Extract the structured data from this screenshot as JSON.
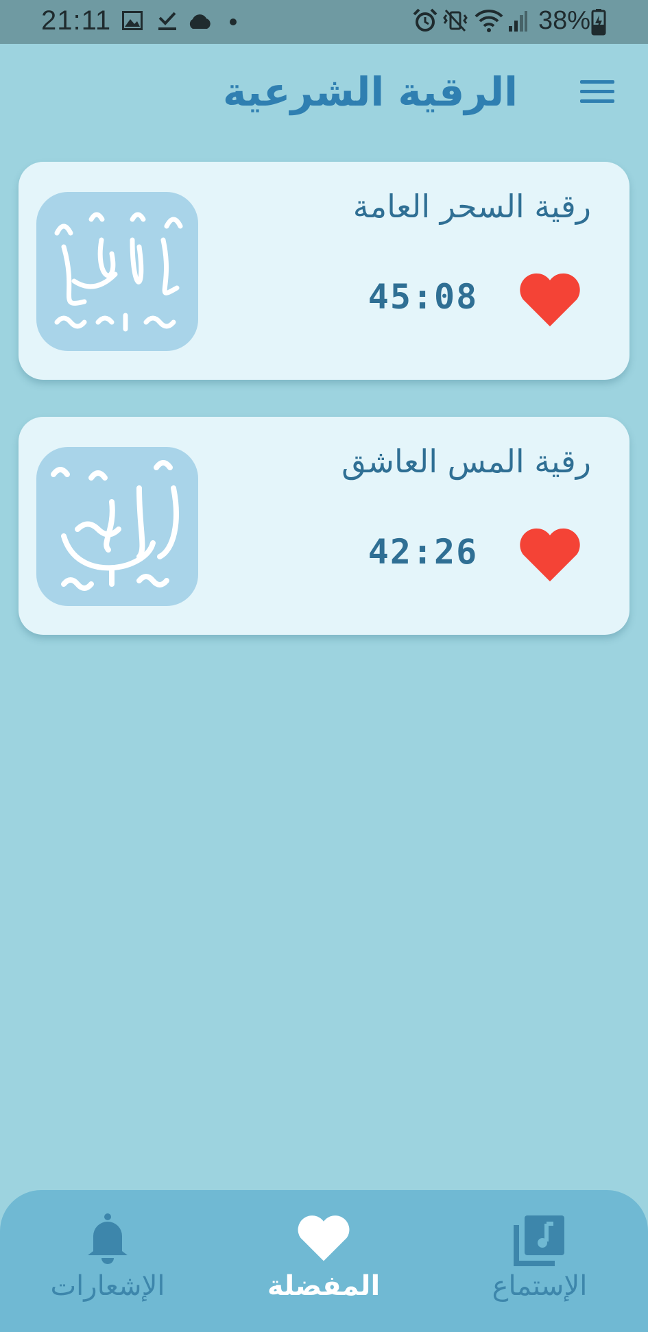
{
  "status_bar": {
    "time": "21:11",
    "battery_percent": "38%",
    "icons_left": [
      "image-icon",
      "download-done-icon",
      "cloud-icon",
      "dot-icon"
    ],
    "icons_right": [
      "alarm-icon",
      "vibrate-mute-icon",
      "wifi-icon",
      "signal-icon",
      "battery-charging-icon"
    ]
  },
  "header": {
    "title": "الرقية الشرعية",
    "menu_icon": "hamburger-menu-icon"
  },
  "favorites": [
    {
      "title": "رقية السحر العامة",
      "duration": "45:08",
      "favorited": true,
      "thumb_icon": "calligraphy-zawaj-icon"
    },
    {
      "title": "رقية المس العاشق",
      "duration": "42:26",
      "favorited": true,
      "thumb_icon": "calligraphy-mass-icon"
    }
  ],
  "bottom_nav": {
    "items": [
      {
        "label": "الإشعارات",
        "icon": "bell-icon",
        "active": false
      },
      {
        "label": "المفضلة",
        "icon": "heart-icon",
        "active": true
      },
      {
        "label": "الإستماع",
        "icon": "music-library-icon",
        "active": false
      }
    ]
  },
  "colors": {
    "background": "#9dd3df",
    "accent": "#2f7fb1",
    "card": "#e4f5fa",
    "heart": "#f44336",
    "nav_bg": "#70b9d3"
  }
}
